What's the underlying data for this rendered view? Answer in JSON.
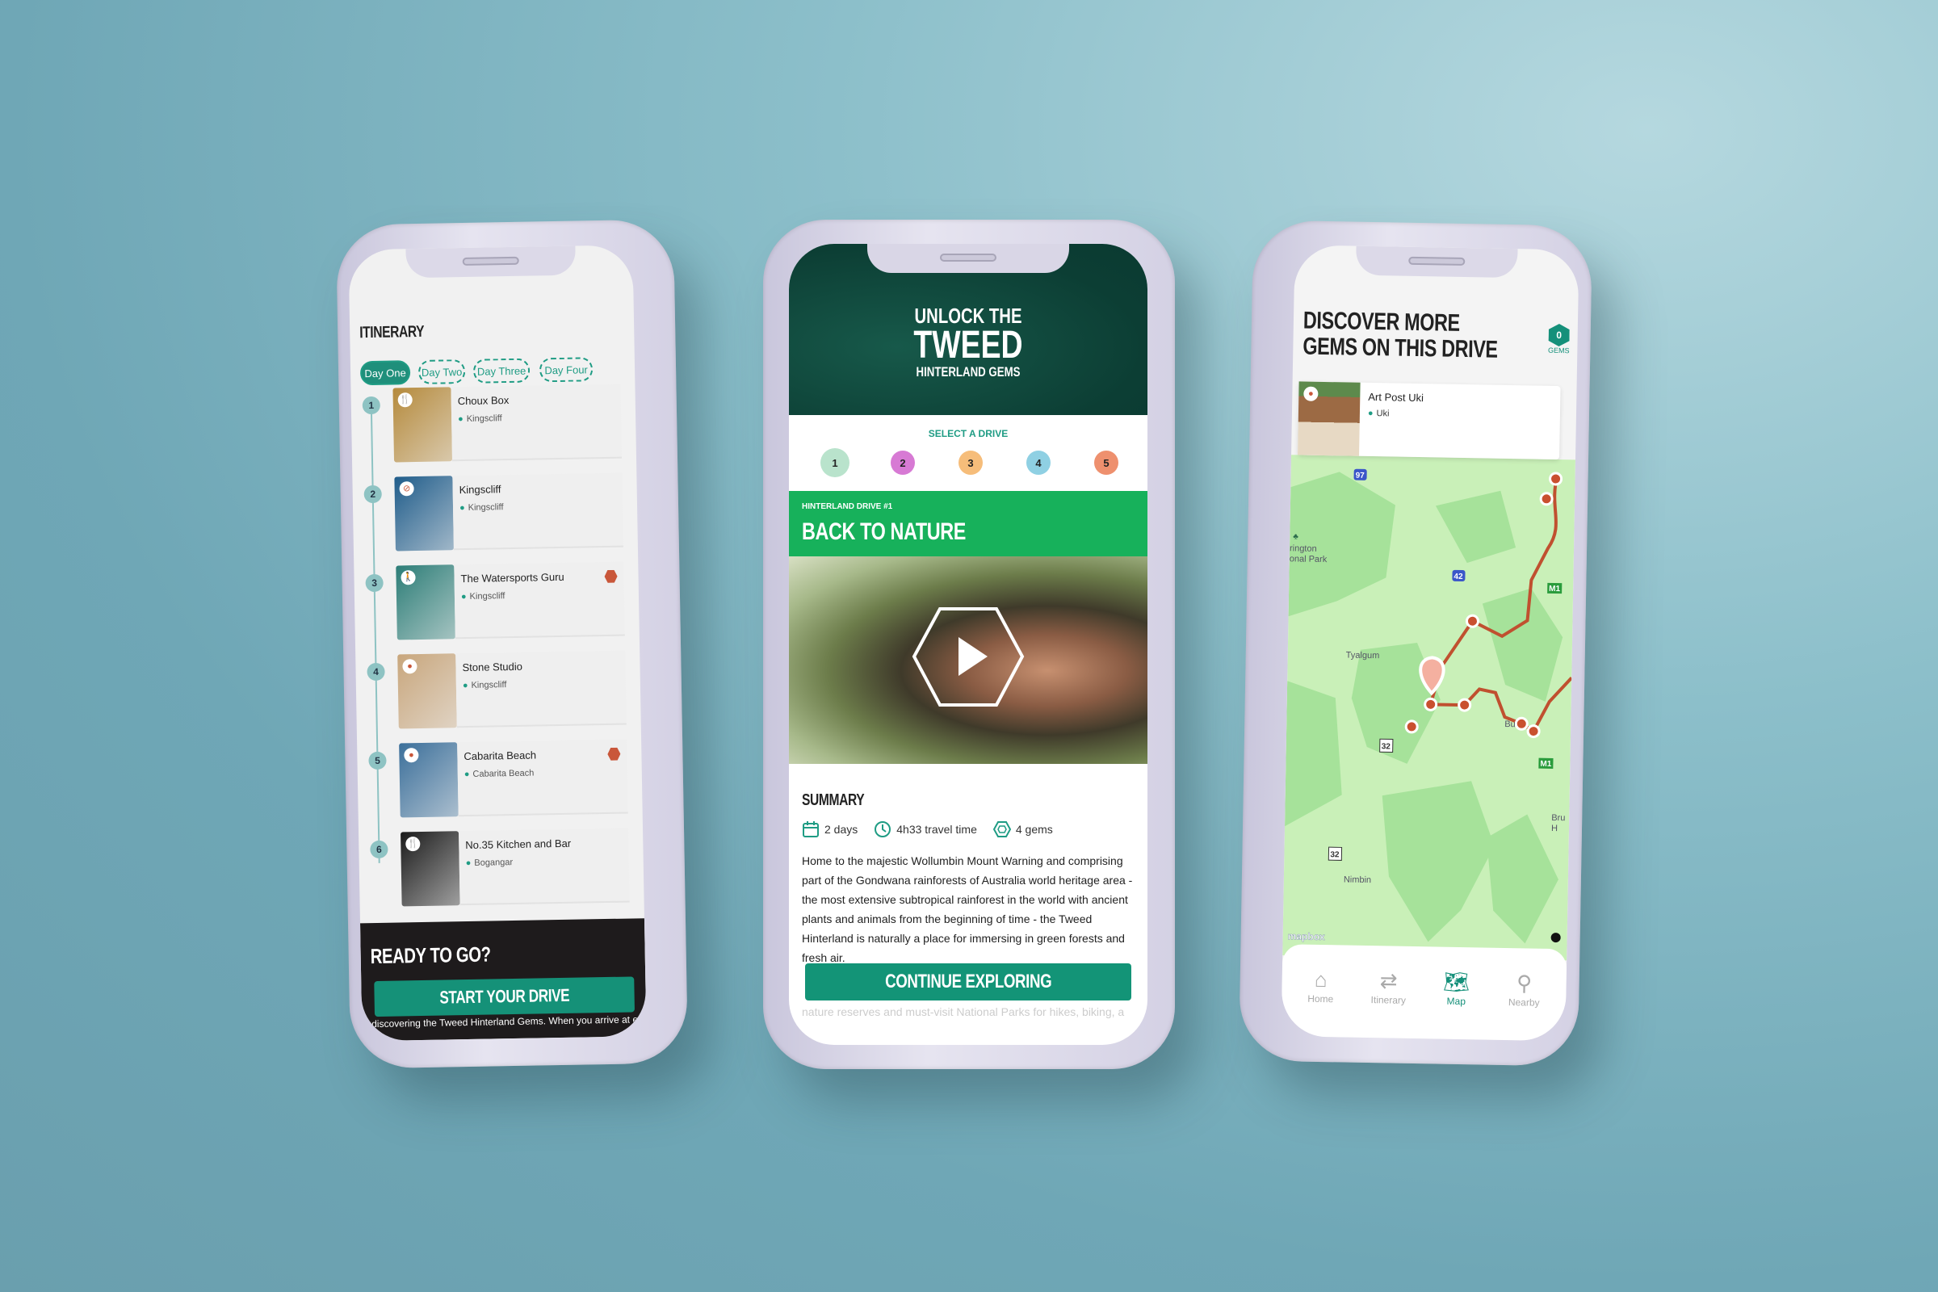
{
  "itinerary": {
    "title": "ITINERARY",
    "days": [
      "Day One",
      "Day Two",
      "Day Three",
      "Day Four"
    ],
    "active_day": "Day One",
    "items": [
      {
        "num": "1",
        "name": "Choux Box",
        "location": "Kingscliff",
        "category": "restaurant-icon",
        "gem": false,
        "img": "#b58a3c"
      },
      {
        "num": "2",
        "name": "Kingscliff",
        "location": "Kingscliff",
        "category": "activity-icon",
        "gem": false,
        "img": "#1f5c8a"
      },
      {
        "num": "3",
        "name": "The Watersports Guru",
        "location": "Kingscliff",
        "category": "hiking-icon",
        "gem": true,
        "img": "#2c7d77"
      },
      {
        "num": "4",
        "name": "Stone Studio",
        "location": "Kingscliff",
        "category": "location-icon",
        "gem": false,
        "img": "#c8a67c"
      },
      {
        "num": "5",
        "name": "Cabarita Beach",
        "location": "Cabarita Beach",
        "category": "location-icon",
        "gem": true,
        "img": "#3b6f9a"
      },
      {
        "num": "6",
        "name": "No.35 Kitchen and Bar",
        "location": "Bogangar",
        "category": "restaurant-icon",
        "gem": false,
        "img": "#1b1b1b"
      }
    ],
    "footer": {
      "title": "READY TO GO?",
      "button": "START YOUR DRIVE",
      "text": "discovering the Tweed Hinterland Gems. When you arrive at each"
    }
  },
  "drive": {
    "logo": {
      "line1": "UNLOCK THE",
      "line2": "TWEED",
      "line3": "HINTERLAND GEMS"
    },
    "select_label": "SELECT A DRIVE",
    "drives": [
      {
        "n": "1",
        "color": "#b9e3cc"
      },
      {
        "n": "2",
        "color": "#d77ad4"
      },
      {
        "n": "3",
        "color": "#f6bd7a"
      },
      {
        "n": "4",
        "color": "#8fd0e3"
      },
      {
        "n": "5",
        "color": "#ee906e"
      }
    ],
    "selected": "1",
    "subtitle": "HINTERLAND DRIVE #1",
    "title": "BACK TO NATURE",
    "summary_title": "SUMMARY",
    "stats": {
      "days": "2 days",
      "time": "4h33 travel time",
      "gems": "4 gems"
    },
    "description": "Home to the majestic Wollumbin Mount Warning and comprising part of the Gondwana rainforests of Australia world heritage area - the most extensive subtropical rainforest in the world with ancient plants and animals from the beginning of time - the Tweed Hinterland is naturally a place for immersing in green forests and fresh air.",
    "button": "CONTINUE EXPLORING",
    "faded_text": "nature reserves and must-visit National Parks for hikes, biking, a",
    "colors": {
      "header": "#0d4a3a",
      "banner": "#17b15b",
      "button": "#139477"
    }
  },
  "map": {
    "title1": "DISCOVER MORE",
    "title2": "GEMS ON THIS DRIVE",
    "gem_count": "0",
    "gem_label": "GEMS",
    "card": {
      "name": "Art Post Uki",
      "location": "Uki"
    },
    "labels": {
      "tyalgum": "Tyalgum",
      "nimbin": "Nimbin",
      "park": "rington\nonal Park",
      "bru": "Bru\nH",
      "bu": "Bu"
    },
    "shields": {
      "r97": "97",
      "r42": "42",
      "m1": "M1",
      "r32": "32"
    },
    "attribution": "mapbox",
    "nav": [
      {
        "label": "Home",
        "icon": "home-icon"
      },
      {
        "label": "Itinerary",
        "icon": "route-icon"
      },
      {
        "label": "Map",
        "icon": "map-icon",
        "active": true
      },
      {
        "label": "Nearby",
        "icon": "nearby-icon"
      }
    ]
  }
}
